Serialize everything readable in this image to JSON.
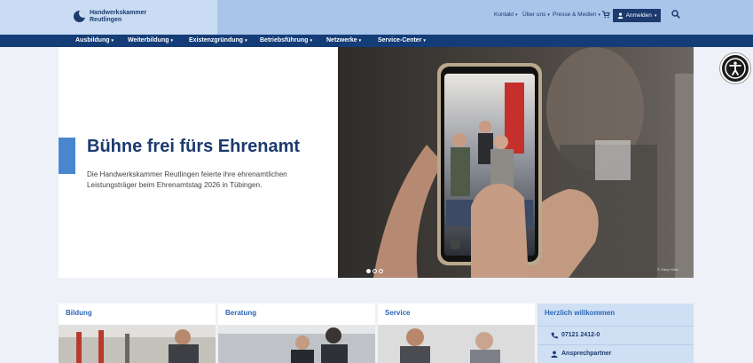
{
  "header": {
    "logo_line1": "Handwerkskammer",
    "logo_line2": "Reutlingen",
    "top_links": [
      "Kontakt",
      "Über uns",
      "Presse & Medien"
    ],
    "login_label": "Anmelden"
  },
  "mainnav": {
    "items": [
      "Ausbildung",
      "Weiterbildung",
      "Existenzgründung",
      "Betriebsführung",
      "Netzwerke",
      "Service-Center"
    ]
  },
  "hero": {
    "title": "Bühne frei fürs Ehrenamt",
    "text": "Die Handwerkskammer Reutlingen feierte ihre ehrenamtlichen Leistungsträger beim Ehrenamtstag 2026 in Tübingen.",
    "credit": "© Gaby Höss",
    "slides": 3,
    "active_slide": 1
  },
  "cards": [
    {
      "title": "Bildung"
    },
    {
      "title": "Beratung"
    },
    {
      "title": "Service"
    }
  ],
  "welcome": {
    "title": "Herzlich willkommen",
    "phone": "07121 2412-0",
    "contact": "Ansprechpartner"
  },
  "icons": [
    "logo-mark",
    "cart-icon",
    "user-icon",
    "search-icon",
    "accessibility-icon",
    "phone-icon",
    "person-icon"
  ],
  "colors": {
    "navy": "#143d77",
    "accent": "#4a86d0",
    "header_bg": "#a9c5ea",
    "link_blue": "#2b66b5"
  }
}
